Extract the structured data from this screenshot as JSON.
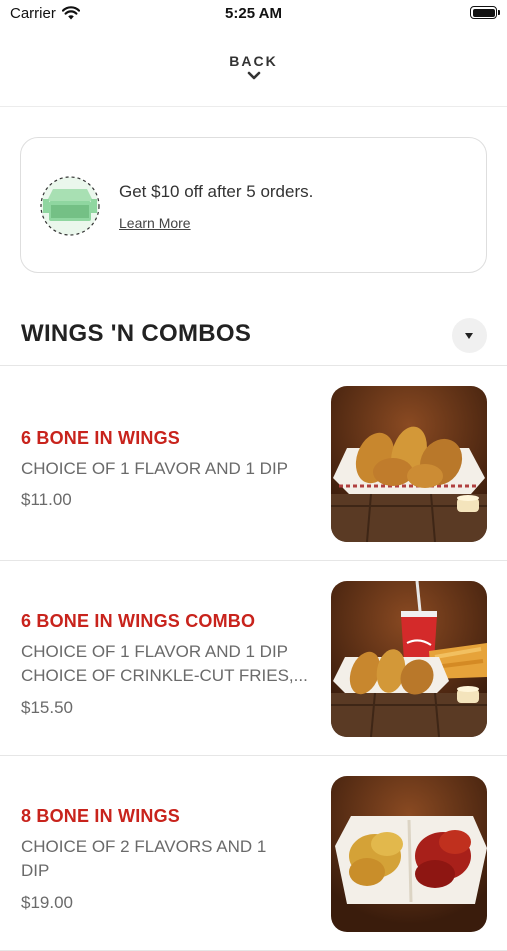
{
  "status_bar": {
    "carrier": "Carrier",
    "time": "5:25 AM"
  },
  "header": {
    "back_label": "BACK"
  },
  "promo": {
    "text": "Get $10 off after 5 orders.",
    "link": "Learn More"
  },
  "section": {
    "title": "WINGS 'N COMBOS"
  },
  "items": [
    {
      "name": "6 BONE IN WINGS",
      "description": "CHOICE OF 1 FLAVOR AND 1 DIP",
      "price": "$11.00"
    },
    {
      "name": "6 BONE IN WINGS COMBO",
      "description": "CHOICE OF 1 FLAVOR AND 1 DIP\nCHOICE OF CRINKLE-CUT FRIES,...",
      "price": "$15.50"
    },
    {
      "name": "8 BONE IN WINGS",
      "description": "CHOICE OF 2 FLAVORS AND 1\nDIP",
      "price": "$19.00"
    }
  ],
  "colors": {
    "accent": "#c8231c",
    "text_muted": "#6a6a6a",
    "promo_green": "#8fd6a0"
  },
  "icons": [
    "wifi-icon",
    "battery-icon",
    "chevron-down-icon",
    "reward-box-icon",
    "caret-down-icon"
  ]
}
